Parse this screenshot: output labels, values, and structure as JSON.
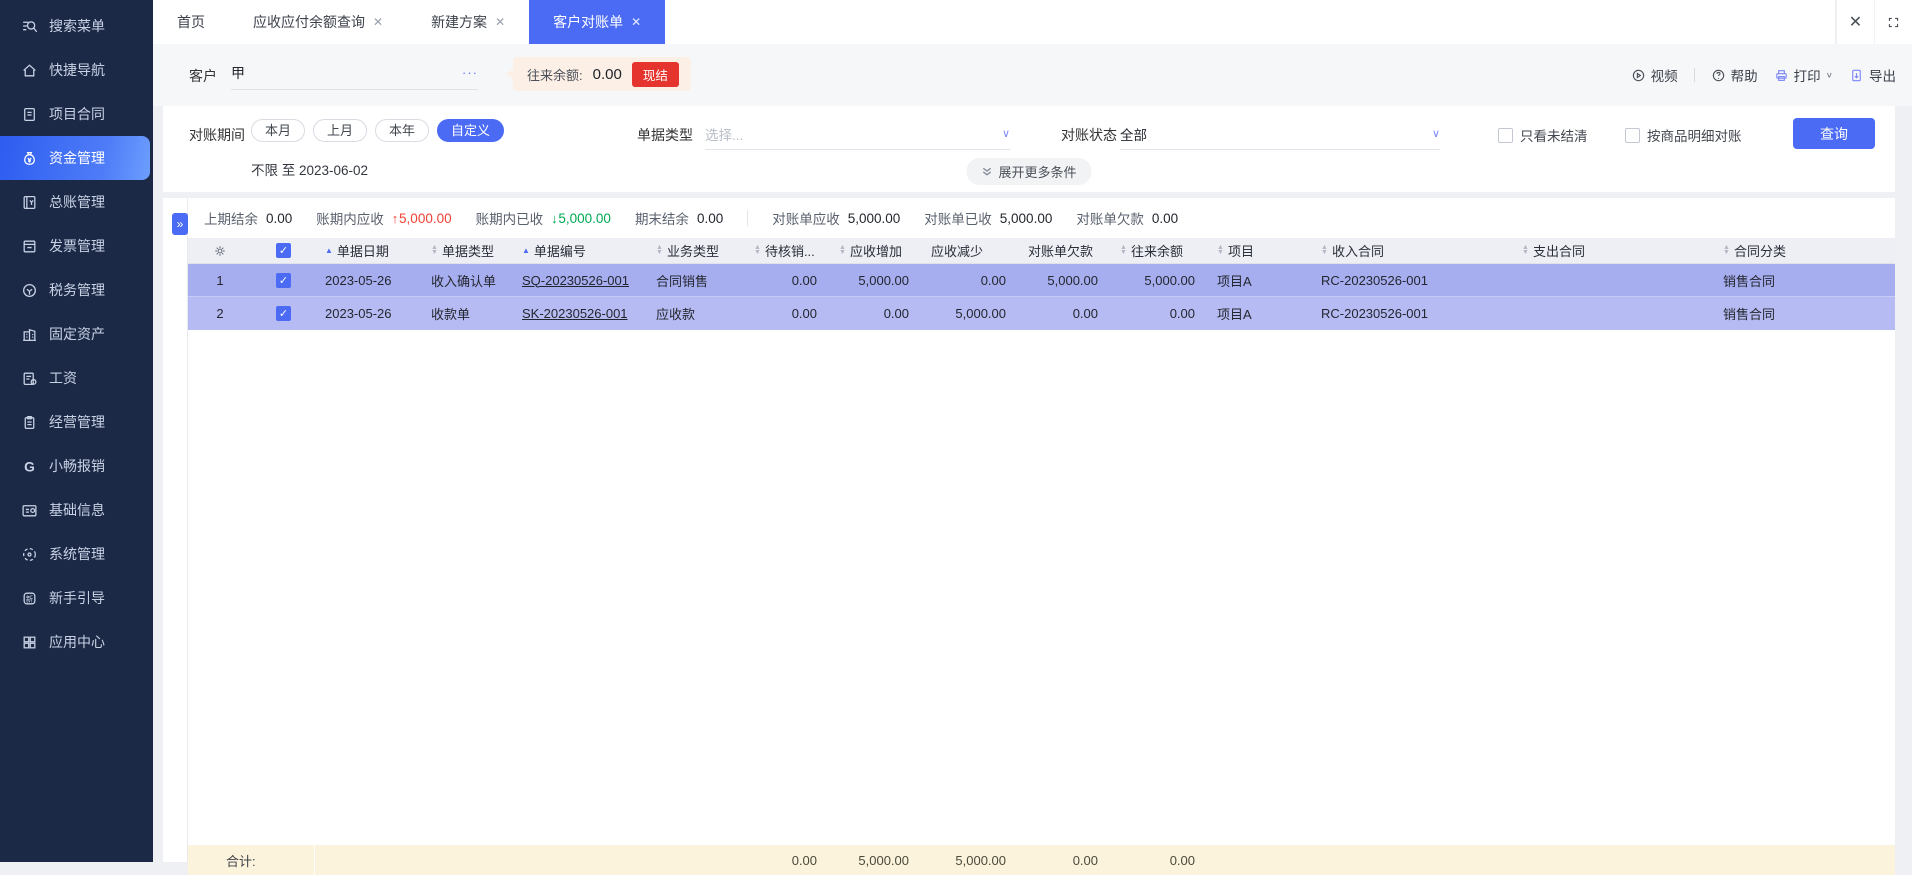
{
  "colors": {
    "accent_blue": "#4b6bf5",
    "sidebar_bg": "#1b2947",
    "danger_red": "#e5332e",
    "positive_green": "#00a854",
    "negative_red": "#f04134",
    "row_selected": "#a7aef0",
    "footer_bg": "#fcf3dd"
  },
  "icons": {
    "up_arrow": "↑",
    "down_arrow": "↓",
    "sort_asc": "▲",
    "sort_desc": "▼",
    "check": "✓",
    "chevron_down": "∨",
    "more_ellipsis": "···",
    "collapse_handle": "»",
    "close": "✕"
  },
  "sidebar": {
    "items": [
      {
        "label": "搜索菜单",
        "icon": "search-menu-icon"
      },
      {
        "label": "快捷导航",
        "icon": "home-icon"
      },
      {
        "label": "项目合同",
        "icon": "contract-doc-icon"
      },
      {
        "label": "资金管理",
        "icon": "money-bag-icon",
        "active": true
      },
      {
        "label": "总账管理",
        "icon": "ledger-icon"
      },
      {
        "label": "发票管理",
        "icon": "invoice-icon"
      },
      {
        "label": "税务管理",
        "icon": "tax-coin-icon"
      },
      {
        "label": "固定资产",
        "icon": "building-icon"
      },
      {
        "label": "工资",
        "icon": "salary-sheet-icon"
      },
      {
        "label": "经营管理",
        "icon": "clipboard-icon"
      },
      {
        "label": "小畅报销",
        "icon": "g-logo-icon"
      },
      {
        "label": "基础信息",
        "icon": "id-card-icon"
      },
      {
        "label": "系统管理",
        "icon": "system-gear-icon"
      },
      {
        "label": "新手引导",
        "icon": "guide-icon"
      },
      {
        "label": "应用中心",
        "icon": "app-grid-icon"
      }
    ]
  },
  "tabs": {
    "items": [
      {
        "label": "首页",
        "closable": false,
        "active": false
      },
      {
        "label": "应收应付余额查询",
        "closable": true,
        "active": false
      },
      {
        "label": "新建方案",
        "closable": true,
        "active": false
      },
      {
        "label": "客户对账单",
        "closable": true,
        "active": true
      }
    ]
  },
  "toolbar": {
    "customer_label": "客户",
    "customer_value": "甲",
    "balance_label": "往来余额:",
    "balance_value": "0.00",
    "settle_button": "现结",
    "video": "视频",
    "help": "帮助",
    "print": "打印",
    "export": "导出"
  },
  "filters": {
    "period_label": "对账期间",
    "period_options": [
      {
        "label": "本月",
        "active": false
      },
      {
        "label": "上月",
        "active": false
      },
      {
        "label": "本年",
        "active": false
      },
      {
        "label": "自定义",
        "active": true
      }
    ],
    "period_range": "不限 至 2023-06-02",
    "doc_type_label": "单据类型",
    "doc_type_placeholder": "选择...",
    "status_label": "对账状态",
    "status_value": "全部",
    "checkbox_unsettled": {
      "label": "只看未结清",
      "checked": false
    },
    "checkbox_by_item": {
      "label": "按商品明细对账",
      "checked": false
    },
    "query_button": "查询",
    "expand_more": "展开更多条件"
  },
  "summary": {
    "group1": [
      {
        "label": "上期结余",
        "value": "0.00",
        "trend": ""
      },
      {
        "label": "账期内应收",
        "value": "5,000.00",
        "trend": "up"
      },
      {
        "label": "账期内已收",
        "value": "5,000.00",
        "trend": "down"
      },
      {
        "label": "期末结余",
        "value": "0.00",
        "trend": ""
      }
    ],
    "group2": [
      {
        "label": "对账单应收",
        "value": "5,000.00"
      },
      {
        "label": "对账单已收",
        "value": "5,000.00"
      },
      {
        "label": "对账单欠款",
        "value": "0.00"
      }
    ]
  },
  "table": {
    "columns": [
      {
        "label": "",
        "type": "gear"
      },
      {
        "label": "",
        "type": "checkbox",
        "checked": true
      },
      {
        "label": "单据日期",
        "sort": "asc-active"
      },
      {
        "label": "单据类型",
        "sort": "both"
      },
      {
        "label": "单据编号",
        "sort": "asc-active"
      },
      {
        "label": "业务类型",
        "sort": "both"
      },
      {
        "label": "待核销...",
        "sort": "both"
      },
      {
        "label": "应收增加",
        "sort": "both"
      },
      {
        "label": "应收减少",
        "sort": "none"
      },
      {
        "label": "对账单欠款",
        "sort": "none"
      },
      {
        "label": "往来余额",
        "sort": "both"
      },
      {
        "label": "项目",
        "sort": "both"
      },
      {
        "label": "收入合同",
        "sort": "both"
      },
      {
        "label": "支出合同",
        "sort": "both"
      },
      {
        "label": "合同分类",
        "sort": "both"
      }
    ],
    "rows": [
      {
        "seq": "1",
        "checked": true,
        "date": "2023-05-26",
        "doc_type": "收入确认单",
        "doc_no": "SQ-20230526-001",
        "biz_type": "合同销售",
        "pending": "0.00",
        "ar_increase": "5,000.00",
        "ar_decrease": "0.00",
        "statement_debt": "5,000.00",
        "balance": "5,000.00",
        "project": "项目A",
        "income_contract": "RC-20230526-001",
        "expense_contract": "",
        "contract_category": "销售合同"
      },
      {
        "seq": "2",
        "checked": true,
        "date": "2023-05-26",
        "doc_type": "收款单",
        "doc_no": "SK-20230526-001",
        "biz_type": "应收款",
        "pending": "0.00",
        "ar_increase": "0.00",
        "ar_decrease": "5,000.00",
        "statement_debt": "0.00",
        "balance": "0.00",
        "project": "项目A",
        "income_contract": "RC-20230526-001",
        "expense_contract": "",
        "contract_category": "销售合同"
      }
    ],
    "footer": {
      "label": "合计:",
      "pending": "0.00",
      "ar_increase": "5,000.00",
      "ar_decrease": "5,000.00",
      "statement_debt": "0.00",
      "balance": "0.00"
    }
  }
}
